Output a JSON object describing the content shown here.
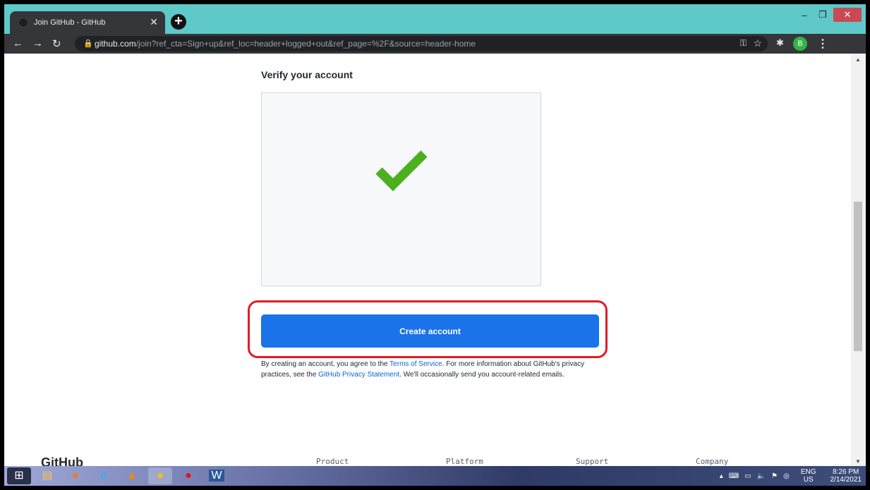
{
  "browser": {
    "tab_title": "Join GitHub - GitHub",
    "url_host": "github.com",
    "url_path": "/join?ref_cta=Sign+up&ref_loc=header+logged+out&ref_page=%2F&source=header-home",
    "profile_initial": "B"
  },
  "page": {
    "heading": "Verify your account",
    "create_button": "Create account",
    "legal_1": "By creating an account, you agree to the ",
    "terms_link": "Terms of Service",
    "legal_2": ". For more information about GitHub's privacy practices, see the ",
    "privacy_link": "GitHub Privacy Statement",
    "legal_3": ". We'll occasionally send you account-related emails."
  },
  "footer": {
    "logo": "GitHub",
    "links": [
      "Product",
      "Platform",
      "Support",
      "Company"
    ]
  },
  "taskbar": {
    "lang_top": "ENG",
    "lang_bottom": "US",
    "time": "8:26 PM",
    "date": "2/14/2021"
  },
  "colors": {
    "accent": "#1a73e8",
    "check": "#4caf1e",
    "highlight": "#e31b23",
    "tabbar": "#5fc8c8"
  }
}
